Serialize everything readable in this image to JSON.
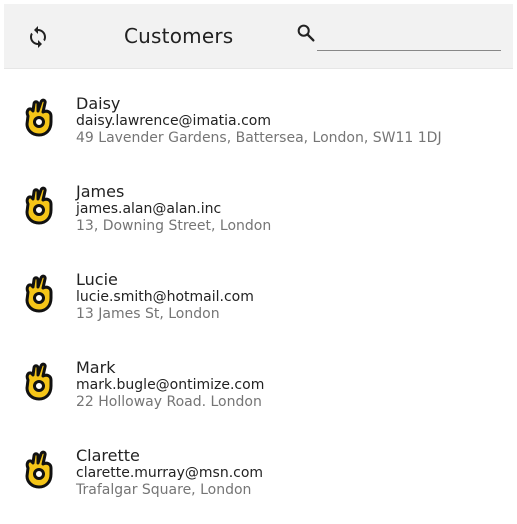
{
  "toolbar": {
    "title": "Customers",
    "refresh_icon": "refresh-icon",
    "search_icon": "search-icon",
    "search_value": "",
    "search_placeholder": ""
  },
  "customers": [
    {
      "name": "Daisy",
      "email": "daisy.lawrence@imatia.com",
      "address": "49 Lavender Gardens, Battersea, London, SW11 1DJ",
      "avatar_icon": "hand-ok-icon"
    },
    {
      "name": "James",
      "email": "james.alan@alan.inc",
      "address": "13, Downing Street, London",
      "avatar_icon": "hand-ok-icon"
    },
    {
      "name": "Lucie",
      "email": "lucie.smith@hotmail.com",
      "address": "13 James St, London",
      "avatar_icon": "hand-ok-icon"
    },
    {
      "name": "Mark",
      "email": "mark.bugle@ontimize.com",
      "address": "22 Holloway Road. London",
      "avatar_icon": "hand-ok-icon"
    },
    {
      "name": "Clarette",
      "email": "clarette.murray@msn.com",
      "address": "Trafalgar Square, London",
      "avatar_icon": "hand-ok-icon"
    }
  ],
  "colors": {
    "toolbar_bg": "#f2f2f2",
    "avatar_fill": "#f5c518",
    "avatar_outline": "#111111",
    "secondary_text": "#757575"
  }
}
